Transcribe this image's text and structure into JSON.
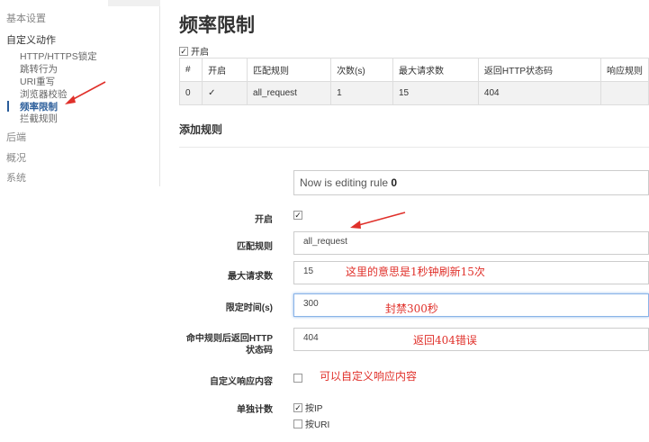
{
  "sidebar": {
    "sections": [
      "基本设置",
      "自定义动作",
      "后端",
      "概况",
      "系统"
    ],
    "items": [
      "HTTP/HTTPS锁定",
      "跳转行为",
      "URI重写",
      "浏览器校验",
      "频率限制",
      "拦截规则"
    ]
  },
  "page": {
    "title": "频率限制",
    "enable_label": "开启"
  },
  "table": {
    "headers": [
      "#",
      "开启",
      "匹配规则",
      "次数(s)",
      "最大请求数",
      "返回HTTP状态码",
      "响应规则"
    ],
    "rows": [
      [
        "0",
        "✓",
        "all_request",
        "1",
        "15",
        "404",
        ""
      ]
    ]
  },
  "form": {
    "add_title": "添加规则",
    "editing_text": "Now is editing rule",
    "editing_index": "0",
    "enable_label": "开启",
    "match_label": "匹配规则",
    "match_value": "all_request",
    "max_label": "最大请求数",
    "max_value": "15",
    "time_label": "限定时间(s)",
    "time_value": "300",
    "code_label_1": "命中规则后返回HTTP",
    "code_label_2": "状态码",
    "code_value": "404",
    "custom_label": "自定义响应内容",
    "count_label": "单独计数",
    "by_ip": "按IP",
    "by_uri": "按URI"
  },
  "annotations": {
    "max_note": "这里的意思是1秒钟刷新15次",
    "time_note": "封禁300秒",
    "code_note": "返回404错误",
    "custom_note": "可以自定义响应内容"
  },
  "colors": {
    "annotation": "#e0302a",
    "active": "#2a5d9a"
  }
}
